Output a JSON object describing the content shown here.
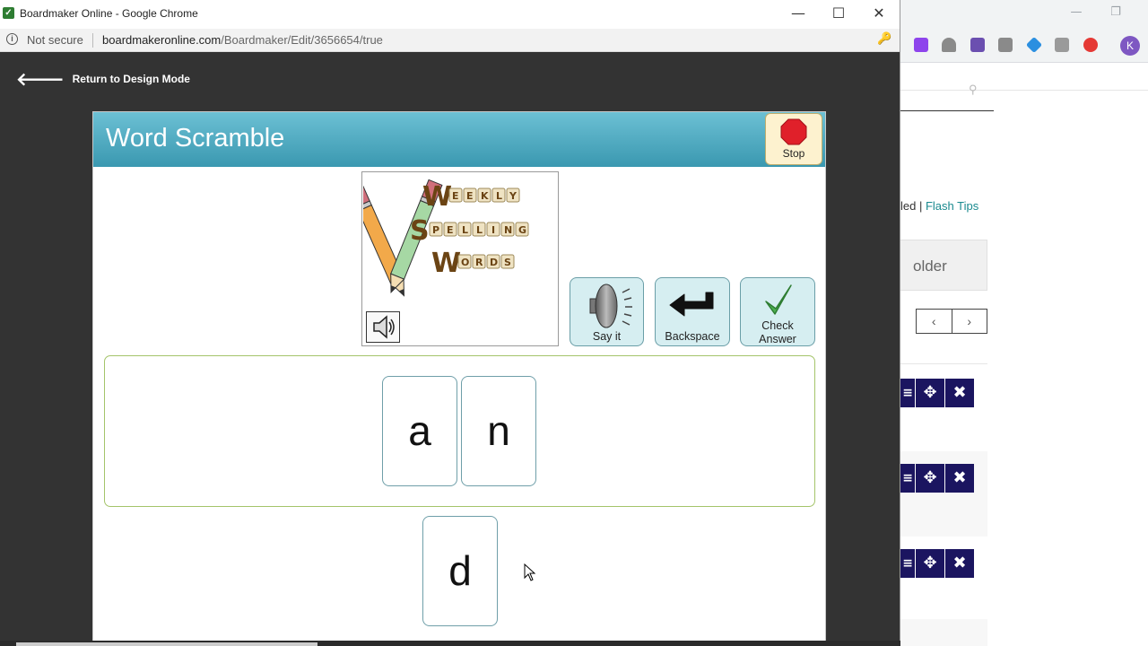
{
  "popup": {
    "window_title": "Boardmaker Online - Google Chrome",
    "security_label": "Not secure",
    "url_host": "boardmakeronline.com",
    "url_path": "/Boardmaker/Edit/3656654/true",
    "minimize": "—",
    "maximize": "☐",
    "close": "✕"
  },
  "app": {
    "return_label": "Return to Design Mode",
    "back_arrow": "🡐"
  },
  "board": {
    "title": "Word Scramble",
    "stop_label": "Stop",
    "logo_words": [
      "WEEKLY",
      "SPELLING",
      "WORDS"
    ],
    "buttons": {
      "say_it": "Say it",
      "backspace": "Backspace",
      "check_line1": "Check",
      "check_line2": "Answer"
    },
    "answer_letters": [
      "a",
      "n"
    ],
    "pool_letters": [
      "d"
    ]
  },
  "background": {
    "links_prefix": "led | ",
    "flash_tips": "Flash Tips",
    "folder_label": "older",
    "pager_prev": "‹",
    "pager_next": "›",
    "avatar_initial": "K",
    "minimize": "—",
    "restore": "❐"
  },
  "colors": {
    "header_start": "#6cc0d4",
    "header_end": "#3a98b0",
    "stop_red": "#e0202a",
    "button_bg": "#d6eef1",
    "answer_border": "#a4c46a",
    "tile_border": "#6f9fa9",
    "link_teal": "#1a8a8f",
    "toolbar_navy": "#1b1560"
  }
}
